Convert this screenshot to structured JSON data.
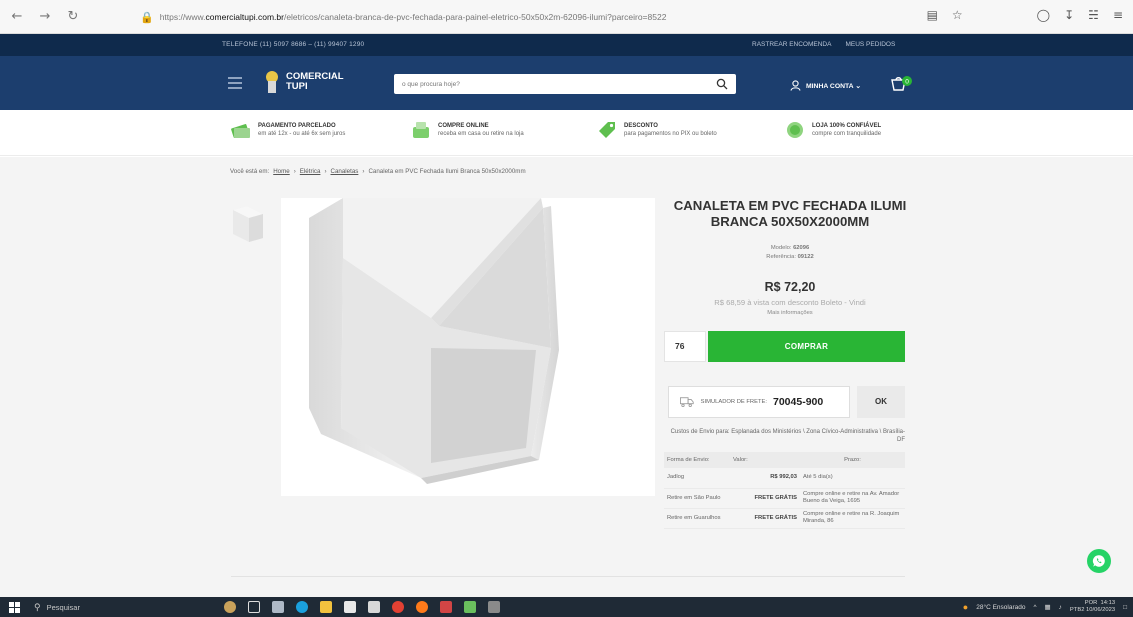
{
  "browser": {
    "url_prefix": "https://www.",
    "url_host": "comercialtupi.com.br",
    "url_path": "/eletricos/canaleta-branca-de-pvc-fechada-para-painel-eletrico-50x50x2m-62096-ilumi?parceiro=8522"
  },
  "topbar": {
    "phones": "TELEFONE (11) 5097 8686 – (11) 99407 1290",
    "track_order": "RASTREAR ENCOMENDA",
    "my_orders": "MEUS PEDIDOS"
  },
  "header": {
    "logo_line1": "COMERCIAL",
    "logo_line2": "TUPI",
    "search_placeholder": "o que procura hoje?",
    "account_label": "MINHA CONTA ⌄",
    "cart_count": "0"
  },
  "benefits": [
    {
      "title": "PAGAMENTO PARCELADO",
      "subtitle": "em até 12x - ou até 6x sem juros",
      "icon": "card-icon"
    },
    {
      "title": "COMPRE ONLINE",
      "subtitle": "receba em casa ou retire na loja",
      "icon": "store-icon"
    },
    {
      "title": "DESCONTO",
      "subtitle": "para pagamentos no PIX ou boleto",
      "icon": "discount-icon"
    },
    {
      "title": "LOJA 100% CONFIÁVEL",
      "subtitle": "compre com tranquilidade",
      "icon": "shield-icon"
    }
  ],
  "breadcrumb": {
    "prefix": "Você está em:",
    "items": [
      "Home",
      "Elétrica",
      "Canaletas"
    ],
    "current": "Canaleta em PVC Fechada Ilumi Branca 50x50x2000mm",
    "sep": "›"
  },
  "product": {
    "title": "CANALETA EM PVC FECHADA ILUMI BRANCA 50X50X2000MM",
    "model_label": "Modelo:",
    "model": "62096",
    "ref_label": "Referência:",
    "ref": "09122",
    "price": "R$ 72,20",
    "price_pix": "R$ 68,59 à vista com desconto Boleto - Vindi",
    "more_info": "Mais informações",
    "quantity": "76",
    "buy_label": "COMPRAR"
  },
  "shipping": {
    "simulator_label": "SIMULADOR DE FRETE:",
    "cep": "70045-900",
    "ok_label": "OK",
    "destination": "Custos de Envio para: Esplanada dos Ministérios \\ Zona Cívico-Administrativa \\ Brasília-DF",
    "headers": [
      "Forma de Envio:",
      "Valor:",
      "Prazo:"
    ],
    "rows": [
      {
        "method": "Jadlog",
        "value": "R$ 992,03",
        "term": "Até 5 dia(s)"
      },
      {
        "method": "Retire em São Paulo",
        "value": "FRETE GRÁTIS",
        "term": "Compre online e retire na Av. Amador Bueno da Veiga, 1695"
      },
      {
        "method": "Retire em Guarulhos",
        "value": "FRETE GRÁTIS",
        "term": "Compre online e retire na R. Joaquim Miranda, 86"
      }
    ]
  },
  "taskbar": {
    "search_placeholder": "Pesquisar",
    "weather": "28°C Ensolarado",
    "lang": "POR",
    "lang2": "PTB2",
    "time": "14:13",
    "date": "10/06/2023"
  },
  "colors": {
    "topbar": "#0f2a4c",
    "header": "#1c3e6e",
    "buy": "#29b535",
    "whatsapp": "#25d366"
  }
}
